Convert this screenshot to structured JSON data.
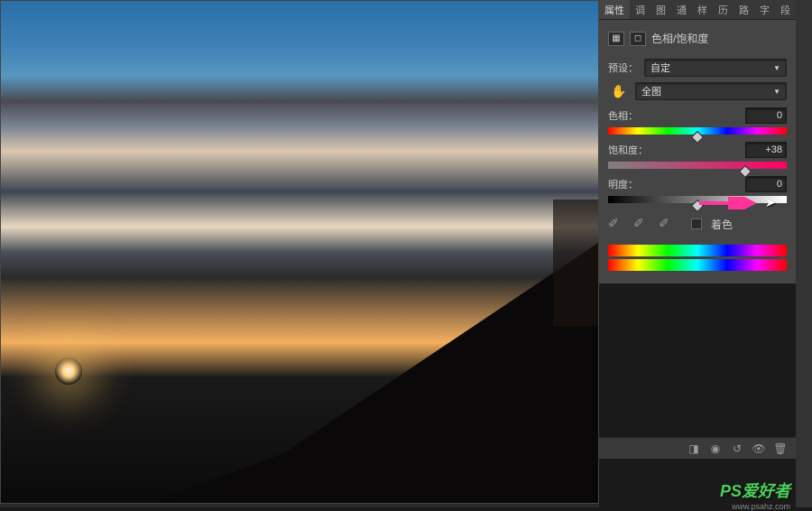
{
  "tabs": {
    "items": [
      "属性",
      "调",
      "图",
      "通",
      "样",
      "历",
      "路",
      "字",
      "段"
    ],
    "active_index": 0
  },
  "panel": {
    "title": "色相/饱和度",
    "preset_label": "预设：",
    "preset_value": "自定",
    "channel_value": "全图",
    "hue": {
      "label": "色相：",
      "value": "0",
      "position": 50
    },
    "saturation": {
      "label": "饱和度：",
      "value": "+38",
      "position": 77
    },
    "lightness": {
      "label": "明度：",
      "value": "0",
      "position": 50
    },
    "colorize_label": "着色"
  },
  "watermark": {
    "text": "PS爱好者",
    "url": "www.psahz.com"
  }
}
